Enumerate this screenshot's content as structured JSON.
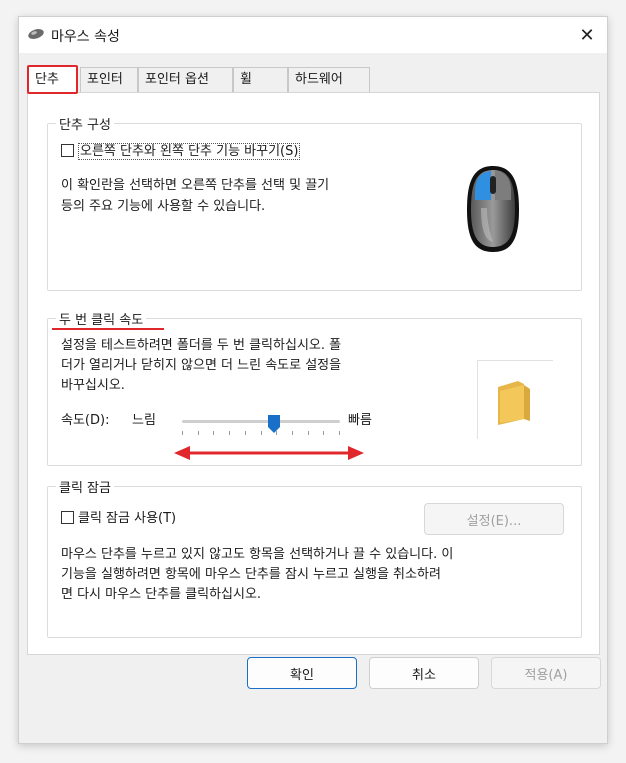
{
  "window": {
    "title": "마우스 속성",
    "close_glyph": "✕"
  },
  "tabs": [
    {
      "label": "단추"
    },
    {
      "label": "포인터"
    },
    {
      "label": "포인터 옵션"
    },
    {
      "label": "휠"
    },
    {
      "label": "하드웨어"
    }
  ],
  "button_config": {
    "group_label": "단추 구성",
    "swap_checkbox_label": "오른쪽 단추와 왼쪽 단추 기능 바꾸기(S)",
    "swap_checked": false,
    "description_line1": "이 확인란을 선택하면 오른쪽 단추를 선택 및 끌기",
    "description_line2": "등의 주요 기능에 사용할 수 있습니다."
  },
  "double_click": {
    "group_label": "두 번 클릭 속도",
    "description_line1": "설정을 테스트하려면 폴더를 두 번 클릭하십시오. 폴",
    "description_line2": "더가 열리거나 닫히지 않으면 더 느린 속도로 설정을",
    "description_line3": "바꾸십시오.",
    "speed_label": "속도(D):",
    "slow_label": "느림",
    "fast_label": "빠름",
    "speed_value_fraction": 0.58
  },
  "click_lock": {
    "group_label": "클릭 잠금",
    "checkbox_label": "클릭 잠금 사용(T)",
    "checked": false,
    "settings_button": "설정(E)...",
    "description_line1": "마우스 단추를 누르고 있지 않고도 항목을 선택하거나 끌 수 있습니다. 이",
    "description_line2": "기능을 실행하려면 항목에 마우스 단추를 잠시 누르고 실행을 취소하려",
    "description_line3": "면 다시 마우스 단추를 클릭하십시오."
  },
  "footer": {
    "ok": "확인",
    "cancel": "취소",
    "apply": "적용(A)"
  },
  "colors": {
    "highlight_red": "#e0282c",
    "mouse_blue": "#2f8fe0",
    "slider_blue": "#1a6fc9",
    "folder_yellow": "#f3c75a"
  }
}
